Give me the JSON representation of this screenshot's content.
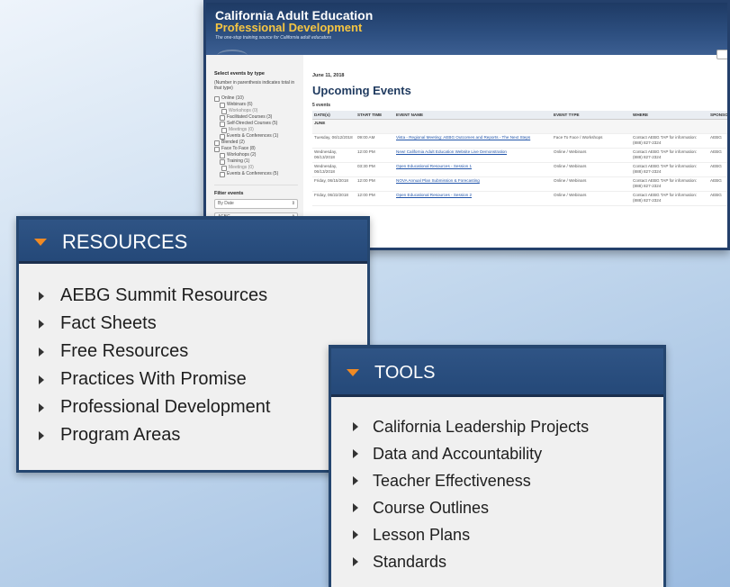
{
  "site": {
    "title": "California Adult Education",
    "subtitle": "Professional Development",
    "tagline": "The one-stop training source for California adult educators",
    "filters": {
      "header": "Select events by type",
      "note": "(Number in parenthesis indicates total in that type)",
      "items": [
        {
          "label": "Online (10)",
          "level": 0
        },
        {
          "label": "Webinars (6)",
          "level": 1
        },
        {
          "label": "Workshops (0)",
          "level": 2
        },
        {
          "label": "Facilitated Courses (3)",
          "level": 1
        },
        {
          "label": "Self-Directed Courses (5)",
          "level": 1
        },
        {
          "label": "Meetings (0)",
          "level": 2
        },
        {
          "label": "Events & Conferences (1)",
          "level": 1
        },
        {
          "label": "Blended (2)",
          "level": 0
        },
        {
          "label": "Face To Face (8)",
          "level": 0
        },
        {
          "label": "Workshops (2)",
          "level": 1
        },
        {
          "label": "Training (1)",
          "level": 1
        },
        {
          "label": "Meetings (0)",
          "level": 2
        },
        {
          "label": "Events & Conferences (5)",
          "level": 1
        }
      ],
      "filter_header": "Filter events",
      "selects": [
        "By Date",
        "AEBG",
        "By Time of Day"
      ]
    },
    "date": "June 11, 2018",
    "heading": "Upcoming Events",
    "count": "5 events",
    "columns": [
      "DATE(s)",
      "START TIME",
      "EVENT NAME",
      "EVENT TYPE",
      "WHERE",
      "SPONSOR"
    ],
    "month": "JUNE",
    "events": [
      {
        "date": "Tuesday, 06/12/2018",
        "time": "09:00 AM",
        "name": "Vista - Regional Meeting: AEBG Outcomes and Reports - The Next Steps",
        "type": "Face To Face / Workshops",
        "where": "Contact AEBG TAP for information: (888) 827-2324",
        "sponsor": "AEBG"
      },
      {
        "date": "Wednesday, 06/13/2018",
        "time": "12:00 PM",
        "name": "New! California Adult Education Website Live Demonstration",
        "type": "Online / Webinars",
        "where": "Contact AEBG TAP for information: (888) 827-2324",
        "sponsor": "AEBG"
      },
      {
        "date": "Wednesday, 06/13/2018",
        "time": "03:30 PM",
        "name": "Open Educational Resources - Session 1",
        "type": "Online / Webinars",
        "where": "Contact AEBG TAP for information: (888) 827-2324",
        "sponsor": "AEBG"
      },
      {
        "date": "Friday, 06/15/2018",
        "time": "12:00 PM",
        "name": "NOVA Annual Plan Submission & Forecasting",
        "type": "Online / Webinars",
        "where": "Contact AEBG TAP for information: (888) 827-2324",
        "sponsor": "AEBG"
      },
      {
        "date": "Friday, 06/22/2018",
        "time": "12:00 PM",
        "name": "Open Educational Resources - Session 2",
        "type": "Online / Webinars",
        "where": "Contact AEBG TAP for information: (888) 827-2324",
        "sponsor": "AEBG"
      }
    ]
  },
  "resources": {
    "title": "RESOURCES",
    "items": [
      "AEBG Summit Resources",
      "Fact Sheets",
      "Free Resources",
      "Practices With Promise",
      "Professional Development",
      "Program Areas"
    ]
  },
  "tools": {
    "title": "TOOLS",
    "items": [
      "California Leadership Projects",
      "Data and Accountability",
      "Teacher Effectiveness",
      "Course Outlines",
      "Lesson Plans",
      "Standards"
    ]
  }
}
